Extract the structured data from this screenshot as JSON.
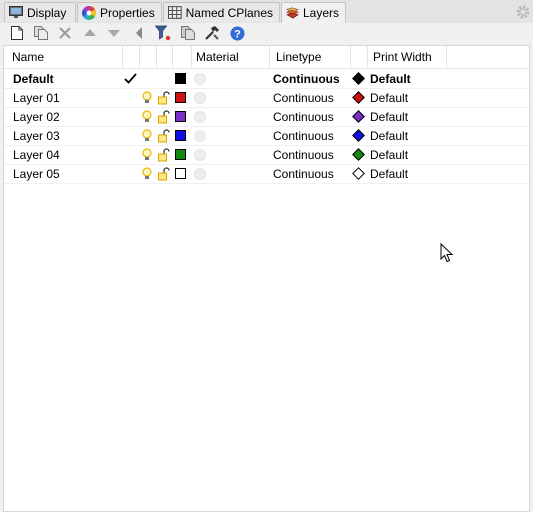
{
  "tabs": [
    {
      "label": "Display",
      "icon": "monitor-icon",
      "active": false
    },
    {
      "label": "Properties",
      "icon": "color-wheel-icon",
      "active": false
    },
    {
      "label": "Named CPlanes",
      "icon": "grid-icon",
      "active": false
    },
    {
      "label": "Layers",
      "icon": "layers-icon",
      "active": true
    }
  ],
  "toolbar": {
    "icons": [
      "new-layer-icon",
      "new-sublayer-icon",
      "delete-icon",
      "move-up-icon",
      "move-down-icon",
      "move-to-parent-icon",
      "filter-icon",
      "copy-icon",
      "tools-icon",
      "help-icon"
    ]
  },
  "columns": {
    "name": "Name",
    "material": "Material",
    "linetype": "Linetype",
    "print_width": "Print Width"
  },
  "layers": [
    {
      "name": "Default",
      "current": true,
      "color": "#000000",
      "linetype": "Continuous",
      "print_color": "#000000",
      "print_width": "Default",
      "bold": true
    },
    {
      "name": "Layer 01",
      "current": false,
      "color": "#cc1111",
      "linetype": "Continuous",
      "print_color": "#cc1111",
      "print_width": "Default",
      "bold": false
    },
    {
      "name": "Layer 02",
      "current": false,
      "color": "#7b2fc8",
      "linetype": "Continuous",
      "print_color": "#7b2fc8",
      "print_width": "Default",
      "bold": false
    },
    {
      "name": "Layer 03",
      "current": false,
      "color": "#1010e0",
      "linetype": "Continuous",
      "print_color": "#1010e0",
      "print_width": "Default",
      "bold": false
    },
    {
      "name": "Layer 04",
      "current": false,
      "color": "#118811",
      "linetype": "Continuous",
      "print_color": "#118811",
      "print_width": "Default",
      "bold": false
    },
    {
      "name": "Layer 05",
      "current": false,
      "color": "#ffffff",
      "linetype": "Continuous",
      "print_color": "#ffffff",
      "print_width": "Default",
      "bold": false
    }
  ],
  "colors": {
    "bulb": "#e8b800",
    "lock": "#d9a400"
  }
}
